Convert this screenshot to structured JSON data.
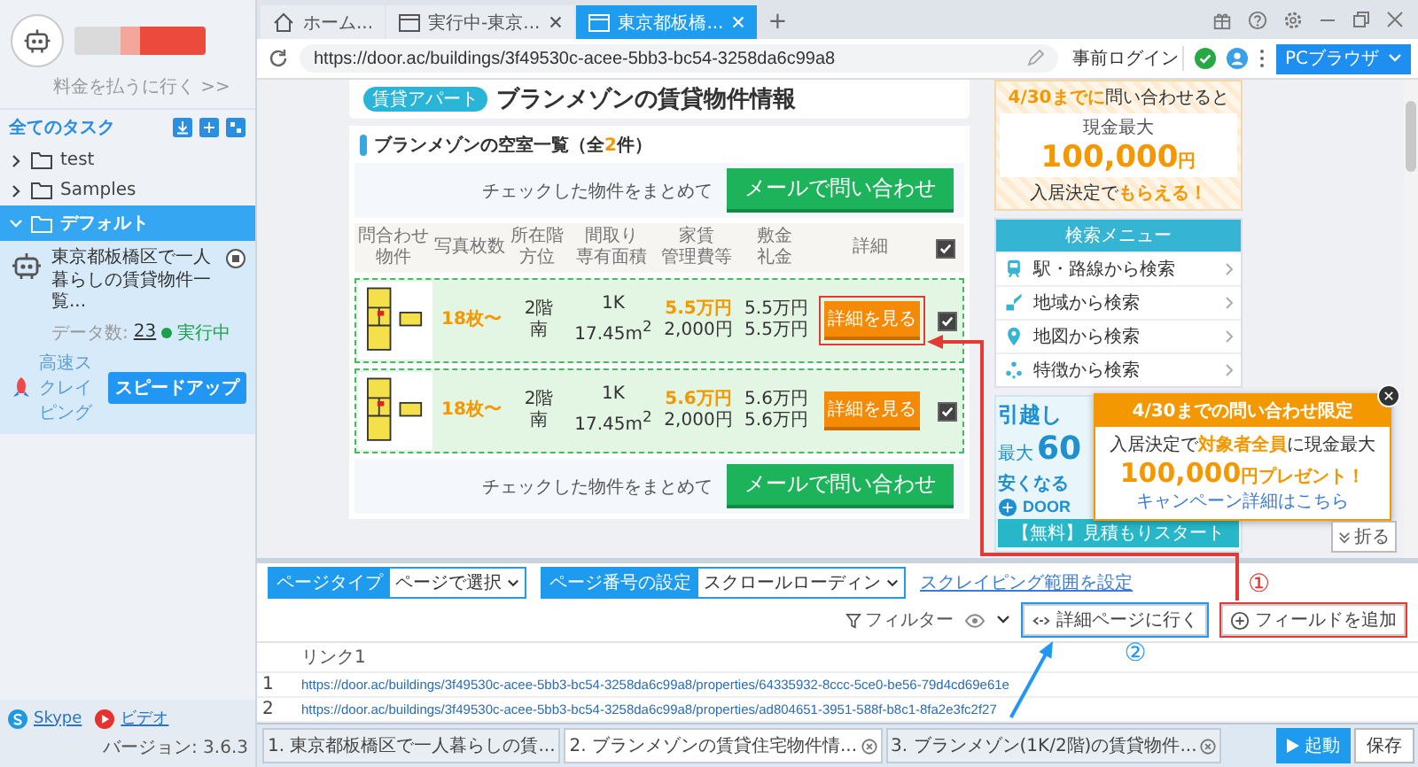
{
  "sidebar": {
    "pay_link": "料金を払うに行く >>",
    "tasks_title": "全てのタスク",
    "tree": [
      {
        "label": "test",
        "expanded": false,
        "selected": false
      },
      {
        "label": "Samples",
        "expanded": false,
        "selected": false
      },
      {
        "label": "デフォルト",
        "expanded": true,
        "selected": true,
        "children": [
          {
            "title": "東京都板橋区で一人暮らしの賃貸物件一覧...",
            "data_label": "データ数:",
            "data_count": "23",
            "status": "実行中",
            "mode": "高速スクレイピング",
            "speed_button": "スピードアップ"
          }
        ]
      }
    ],
    "footer": {
      "links": [
        {
          "label": "Skype",
          "kind": "skype"
        },
        {
          "label": "ビデオ",
          "kind": "video"
        }
      ],
      "version": "バージョン: 3.6.3"
    }
  },
  "browser": {
    "tabs": [
      {
        "label": "ホーム...",
        "kind": "home",
        "selected": false,
        "closable": false
      },
      {
        "label": "実行中-東京...",
        "kind": "page",
        "selected": false,
        "closable": true
      },
      {
        "label": "東京都板橋...",
        "kind": "page",
        "selected": true,
        "closable": true
      }
    ],
    "new_tab": "+",
    "url": "https://door.ac/buildings/3f49530c-acee-5bb3-bc54-3258da6c99a8",
    "login": "事前ログイン",
    "mode_button": "PCブラウザ"
  },
  "page": {
    "badge": "賃貸アパート",
    "title": "ブランメゾンの賃貸物件情報",
    "vacancy_heading": "ブランメゾンの空室一覧（全**2**件）",
    "contact_bars": [
      {
        "note": "チェックした物件をまとめて",
        "button": "メールで問い合わせ"
      },
      {
        "note": "チェックした物件をまとめて",
        "button": "メールで問い合わせ"
      }
    ],
    "table": {
      "columns": [
        [
          "問合わせ物件"
        ],
        [
          "写真枚数"
        ],
        [
          "所在階",
          "方位"
        ],
        [
          "間取り",
          "専有面積"
        ],
        [
          "家賃",
          "管理費等"
        ],
        [
          "敷金",
          "礼金"
        ],
        [
          "詳細"
        ]
      ],
      "all_checked": true,
      "rows": [
        {
          "photos": "18枚〜",
          "floor": "2階",
          "direction": "南",
          "layout": "1K",
          "area": "17.45m$^{2}$",
          "rent": "5.5万円",
          "fee": "2,000円",
          "deposit": "5.5万円",
          "key_money": "5.5万円",
          "button": "詳細を見る",
          "checked": true,
          "selected": true,
          "marked": true
        },
        {
          "photos": "18枚〜",
          "floor": "2階",
          "direction": "南",
          "layout": "1K",
          "area": "17.45m$^{2}$",
          "rent": "5.6万円",
          "fee": "2,000円",
          "deposit": "5.6万円",
          "key_money": "5.6万円",
          "button": "詳細を見る",
          "checked": true,
          "selected": true,
          "marked": false
        }
      ]
    }
  },
  "side": {
    "campaign": {
      "lead": "**4/30までに**問い合わせると",
      "cash_label": "現金最大",
      "amount": "100,000",
      "unit": "円",
      "footer": "入居決定で**もらえる！**"
    },
    "menu": {
      "title": "検索メニュー",
      "items": [
        {
          "label": "駅・路線から検索",
          "kind": "train"
        },
        {
          "label": "地域から検索",
          "kind": "area"
        },
        {
          "label": "地図から検索",
          "kind": "pin"
        },
        {
          "label": "特徴から検索",
          "kind": "sparkle"
        }
      ]
    },
    "banner": {
      "headline": "引越し",
      "prefix": "最大",
      "number": "60",
      "suffix": "安くなる",
      "logo": "DOOR",
      "button": "【無料】見積もりスタート"
    }
  },
  "popup": {
    "header": "4/30までの問い合わせ限定",
    "line": "入居決定で**対象者全員**に現金最大",
    "amount": "100,000",
    "suffix": "円プレゼント！",
    "link": "キャンペーン詳細はこちら"
  },
  "collapse_button": "折る",
  "data_panel": {
    "toolbar": {
      "page_type_label": "ページタイプ",
      "page_type": "ページで選択",
      "paging_label": "ページ番号の設定",
      "paging": "スクロールローディン",
      "range_link": "スクレイピング範囲を設定",
      "filter": "フィルター",
      "buttons": [
        {
          "label": "詳細ページに行く",
          "kind": "link",
          "color": "#2196f3"
        },
        {
          "label": "フィールドを追加",
          "kind": "add",
          "color": "#e53935"
        }
      ]
    },
    "columns": [
      "リンク1"
    ],
    "rows": [
      {
        "index": "1",
        "link": "https://door.ac/buildings/3f49530c-acee-5bb3-bc54-3258da6c99a8/properties/64335932-8ccc-5ce0-be56-79d4cd69e61e"
      },
      {
        "index": "2",
        "link": "https://door.ac/buildings/3f49530c-acee-5bb3-bc54-3258da6c99a8/properties/ad804651-3951-588f-b8c1-8fa2e3fc2f27"
      }
    ]
  },
  "task_tabs": [
    {
      "label": "1. 東京都板橋区で一人暮らしの賃...",
      "selected": false,
      "closable": false
    },
    {
      "label": "2. ブランメゾンの賃貸住宅物件情...",
      "selected": true,
      "closable": true
    },
    {
      "label": "3. ブランメゾン(1K/2階)の賃貸物件...",
      "selected": false,
      "closable": true
    }
  ],
  "run_button": "起動",
  "save_button": "保存",
  "annotations": [
    {
      "label": "①",
      "color": "#e53935",
      "kind": "to-detail-button"
    },
    {
      "label": "②",
      "color": "#2196f3",
      "kind": "from-last-link"
    }
  ]
}
